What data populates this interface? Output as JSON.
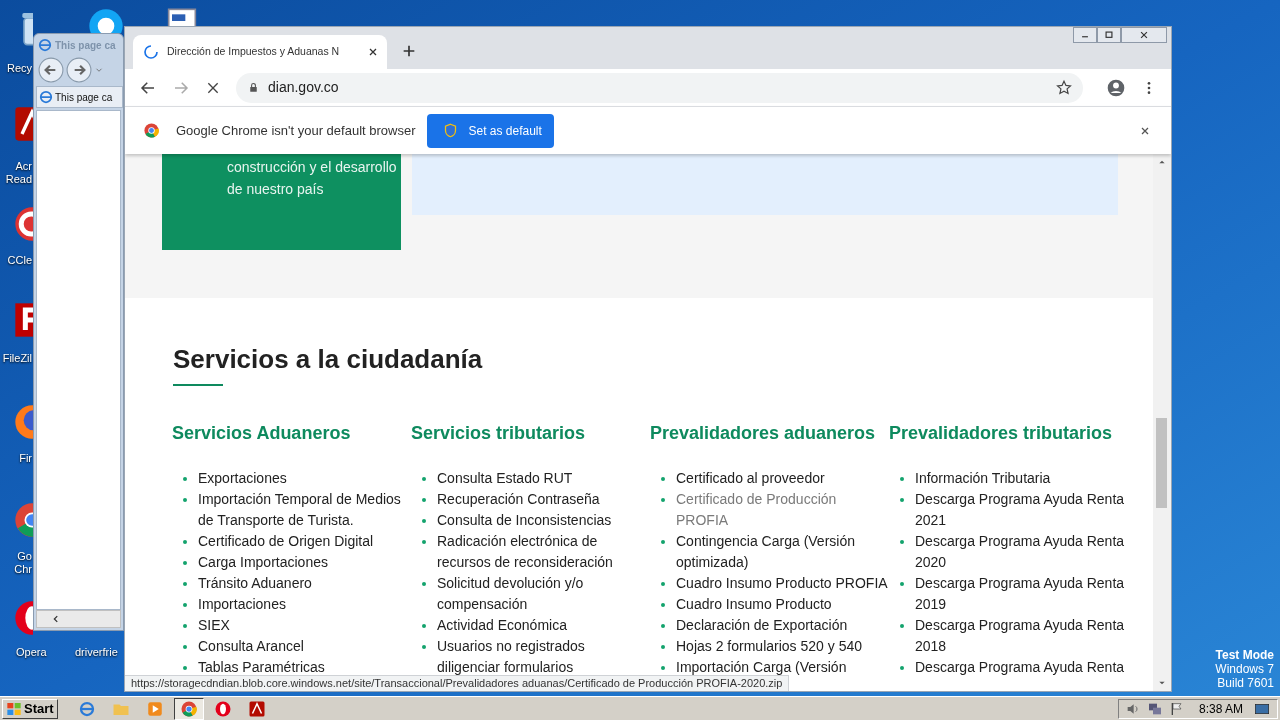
{
  "desktop": {
    "icons": [
      {
        "kind": "bin",
        "label": "Recy"
      },
      {
        "kind": "skype"
      },
      {
        "kind": "document"
      },
      {
        "kind": "acrobat",
        "label": "Acr Read"
      },
      {
        "kind": "ccleaner",
        "label": "CCle"
      },
      {
        "kind": "filezilla",
        "label": "FileZil"
      },
      {
        "kind": "firefox",
        "label": "Fir"
      },
      {
        "kind": "chrome",
        "label": "Go Chr"
      },
      {
        "kind": "opera",
        "label": "Opera"
      },
      {
        "kind": "none",
        "label": "driverfrie"
      }
    ],
    "system_text": [
      "Test Mode",
      "Windows 7",
      "Build 7601"
    ]
  },
  "ie_window": {
    "title": "This page ca",
    "tab": "This page ca"
  },
  "chrome": {
    "tab": {
      "title": "Dirección de Impuestos y Aduanas N",
      "loading": true
    },
    "address": "dian.gov.co",
    "infobar": {
      "message": "Google Chrome isn't your default browser",
      "button": "Set as default"
    },
    "page": {
      "banner_text": "construcción y el desarrollo de nuestro país",
      "section_title": "Servicios a la ciudadanía",
      "columns": [
        {
          "title": "Servicios Aduaneros",
          "items": [
            {
              "label": "Exportaciones",
              "hovered": false
            },
            {
              "label": "Importación Temporal de Medios de Transporte de Turista.",
              "hovered": false
            },
            {
              "label": "Certificado de Origen Digital",
              "hovered": false
            },
            {
              "label": "Carga Importaciones",
              "hovered": false
            },
            {
              "label": "Tránsito Aduanero",
              "hovered": false
            },
            {
              "label": "Importaciones",
              "hovered": false
            },
            {
              "label": "SIEX",
              "hovered": false
            },
            {
              "label": "Consulta Arancel",
              "hovered": false
            },
            {
              "label": "Tablas Paramétricas",
              "hovered": false
            }
          ]
        },
        {
          "title": "Servicios tributarios",
          "items": [
            {
              "label": "Consulta Estado RUT",
              "hovered": false
            },
            {
              "label": "Recuperación Contraseña",
              "hovered": false
            },
            {
              "label": "Consulta de Inconsistencias",
              "hovered": false
            },
            {
              "label": "Radicación electrónica de recursos de reconsideración",
              "hovered": false
            },
            {
              "label": "Solicitud devolución y/o compensación",
              "hovered": false
            },
            {
              "label": "Actividad Económica",
              "hovered": false
            },
            {
              "label": "Usuarios no registrados diligenciar formularios",
              "hovered": false
            }
          ]
        },
        {
          "title": "Prevalidadores aduaneros",
          "items": [
            {
              "label": "Certificado al proveedor",
              "hovered": false
            },
            {
              "label": "Certificado de Producción PROFIA",
              "hovered": true
            },
            {
              "label": "Contingencia Carga (Versión optimizada)",
              "hovered": false
            },
            {
              "label": "Cuadro Insumo Producto PROFIA",
              "hovered": false
            },
            {
              "label": "Cuadro Insumo Producto",
              "hovered": false
            },
            {
              "label": "Declaración de Exportación",
              "hovered": false
            },
            {
              "label": "Hojas 2 formularios 520 y 540",
              "hovered": false
            },
            {
              "label": "Importación Carga (Versión",
              "hovered": false
            }
          ]
        },
        {
          "title": "Prevalidadores tributarios",
          "items": [
            {
              "label": "Información Tributaria",
              "hovered": false
            },
            {
              "label": "Descarga Programa Ayuda Renta 2021",
              "hovered": false
            },
            {
              "label": "Descarga Programa Ayuda Renta 2020",
              "hovered": false
            },
            {
              "label": "Descarga Programa Ayuda Renta 2019",
              "hovered": false
            },
            {
              "label": "Descarga Programa Ayuda Renta 2018",
              "hovered": false
            },
            {
              "label": "Descarga Programa Ayuda Renta",
              "hovered": false
            }
          ]
        }
      ]
    },
    "status_url": "https://storagecdndian.blob.core.windows.net/site/Transaccional/Prevalidadores aduanas/Certificado de Producción PROFIA-2020.zip"
  },
  "taskbar": {
    "start": "Start",
    "apps": [
      {
        "kind": "ie",
        "active": false
      },
      {
        "kind": "folder",
        "active": false
      },
      {
        "kind": "media",
        "active": false
      },
      {
        "kind": "chrome",
        "active": true
      },
      {
        "kind": "opera",
        "active": false
      },
      {
        "kind": "acrobat",
        "active": false
      }
    ],
    "clock": "8:38 AM"
  }
}
